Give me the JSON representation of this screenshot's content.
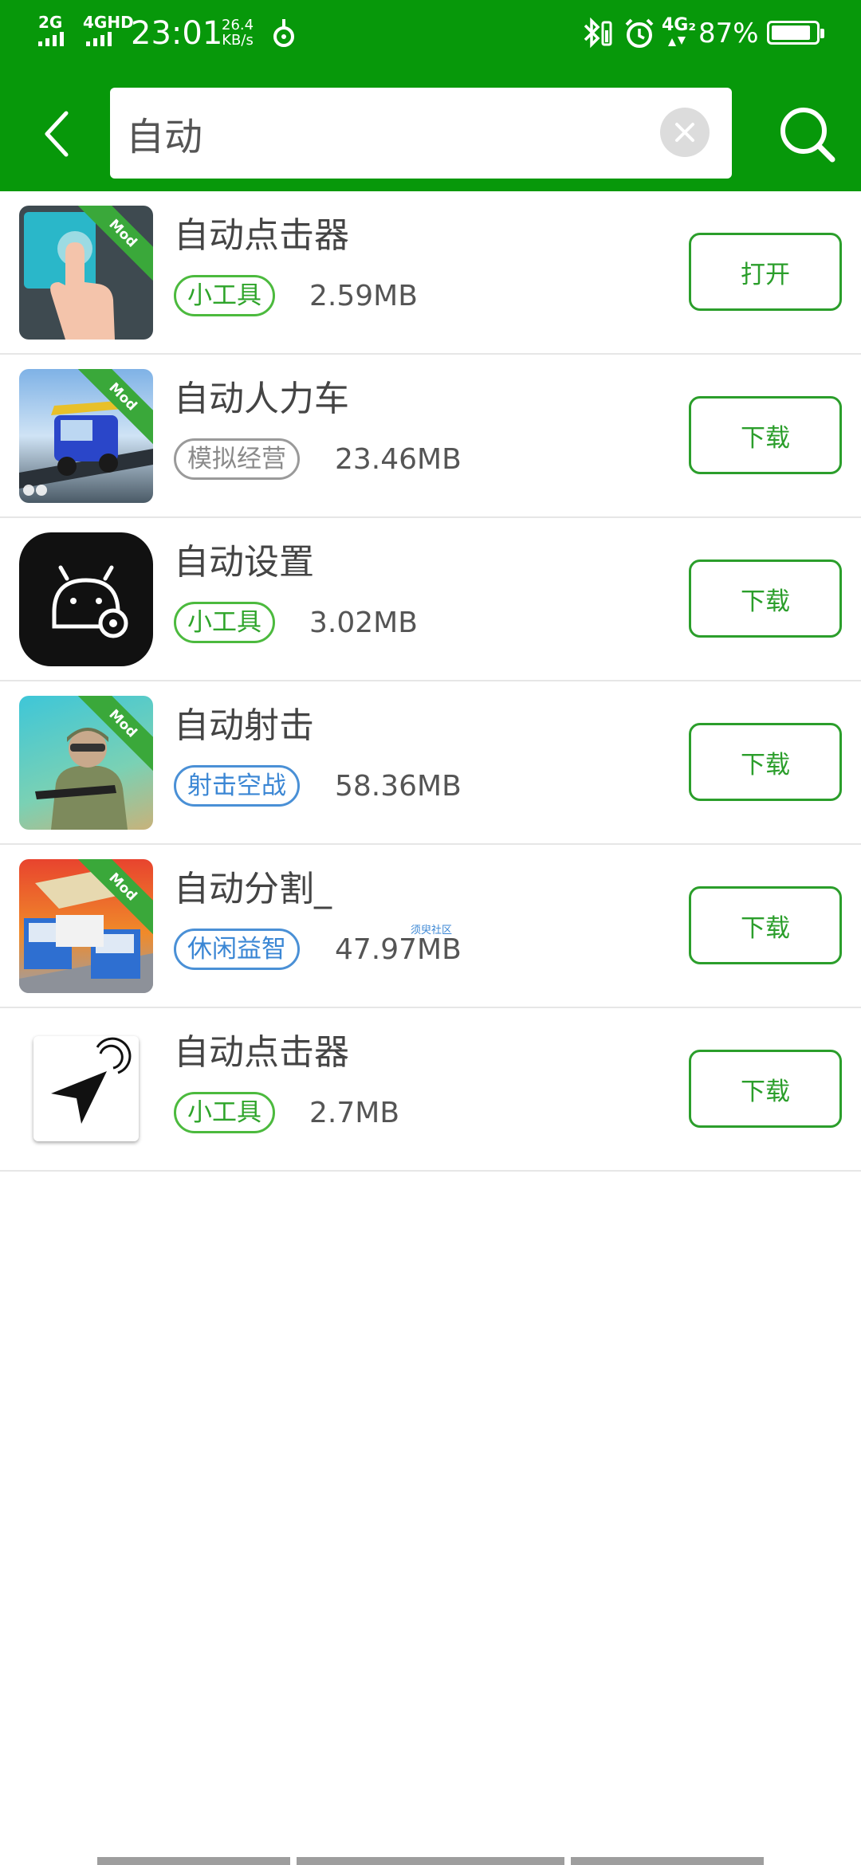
{
  "colors": {
    "brand_green": "#07980a",
    "button_green": "#2b9e2b",
    "tag_green": "#4cba3e",
    "tag_gray": "#9a9a9a",
    "tag_blue": "#4a90d6"
  },
  "status_bar": {
    "sim1_network": "2G",
    "sim2_network": "4GHD",
    "time": "23:01",
    "net_speed_value": "26.4",
    "net_speed_unit": "KB/s",
    "signal_label": "4G₂",
    "battery_percent": "87%"
  },
  "search": {
    "value": "自动",
    "icons": {
      "back": "back-arrow-icon",
      "clear": "clear-icon",
      "search": "search-icon"
    }
  },
  "results": [
    {
      "name": "自动点击器",
      "tag": "小工具",
      "tag_style": "green",
      "size": "2.59MB",
      "action": "打开",
      "mod_badge": "Mod",
      "icon": "hand-tap-icon"
    },
    {
      "name": "自动人力车",
      "tag": "模拟经营",
      "tag_style": "gray",
      "size": "23.46MB",
      "action": "下载",
      "mod_badge": "Mod",
      "icon": "tuk-tuk-icon"
    },
    {
      "name": "自动设置",
      "tag": "小工具",
      "tag_style": "green",
      "size": "3.02MB",
      "action": "下载",
      "mod_badge": "",
      "icon": "android-settings-icon"
    },
    {
      "name": "自动射击",
      "tag": "射击空战",
      "tag_style": "blue",
      "size": "58.36MB",
      "action": "下载",
      "mod_badge": "Mod",
      "icon": "soldier-icon"
    },
    {
      "name": "自动分割_",
      "tag": "休闲益智",
      "tag_style": "blue",
      "size": "47.97MB",
      "action": "下载",
      "mod_badge": "Mod",
      "icon": "trucks-icon",
      "watermark": "须臾社区"
    },
    {
      "name": "自动点击器",
      "tag": "小工具",
      "tag_style": "green",
      "size": "2.7MB",
      "action": "下载",
      "mod_badge": "",
      "icon": "cursor-tap-icon"
    }
  ]
}
